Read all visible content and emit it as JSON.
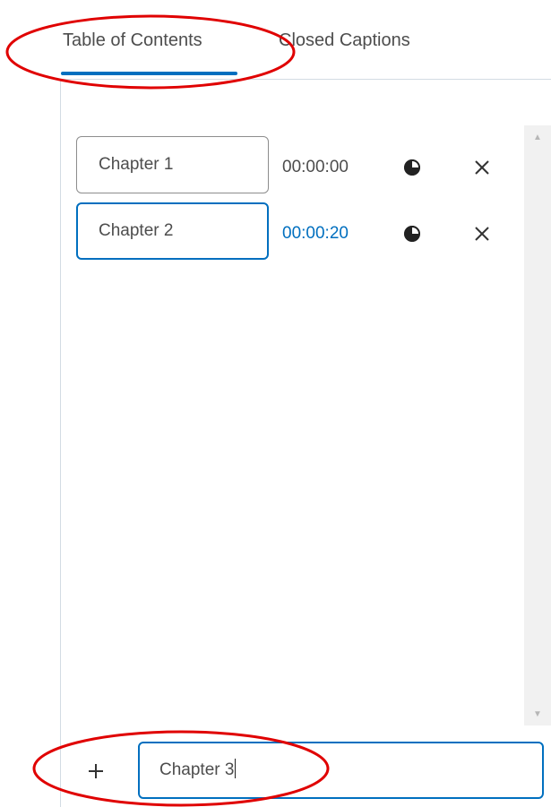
{
  "tabs": [
    {
      "label": "Table of Contents",
      "active": true
    },
    {
      "label": "Closed Captions",
      "active": false
    }
  ],
  "chapters": [
    {
      "title": "Chapter 1",
      "time": "00:00:00",
      "time_active": false
    },
    {
      "title": "Chapter 2",
      "time": "00:00:20",
      "time_active": true
    }
  ],
  "new_chapter": {
    "value": "Chapter 3"
  },
  "icons": {
    "add": "plus-icon",
    "timestamp": "clock-icon",
    "remove": "close-icon",
    "scroll_up": "chevron-up-icon",
    "scroll_down": "chevron-down-icon"
  },
  "colors": {
    "accent": "#006fbf",
    "annotation": "#e00000",
    "text": "#4d4d4d"
  }
}
